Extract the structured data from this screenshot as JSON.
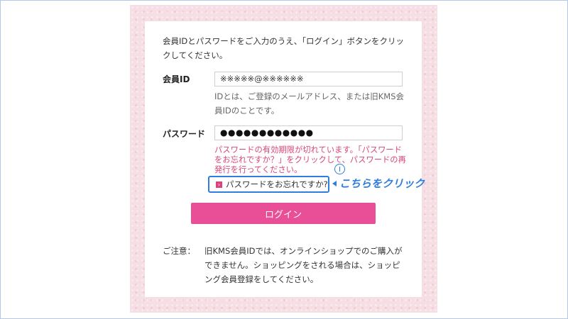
{
  "intro_text": "会員IDとパスワードをご入力のうえ、「ログイン」ボタンをクリックしてください。",
  "member_id": {
    "label": "会員ID",
    "value": "※※※※※@※※※※※※",
    "help": "IDとは、ご登録のメールアドレス、または旧KMS会員IDのことです。"
  },
  "password": {
    "label": "パスワード",
    "masked_value": "●●●●●●●●●●●●"
  },
  "error_message": "パスワードの有効期限が切れています。「パスワードをお忘れですか？」をクリックして、パスワードの再発行を行ってください。",
  "forgot_link_label": "パスワードをお忘れですか?",
  "annotation": {
    "text": "こちらをクリック",
    "color": "#2f7de0"
  },
  "login_button_label": "ログイン",
  "note": {
    "label": "ご注意：",
    "text": "旧KMS会員IDでは、オンラインショップでのご購入ができません。ショッピングをされる場合は、ショッピング会員登録をしてください。"
  },
  "colors": {
    "accent": "#e84f96",
    "error": "#d9457a",
    "background_panel": "#f6dfe4"
  }
}
